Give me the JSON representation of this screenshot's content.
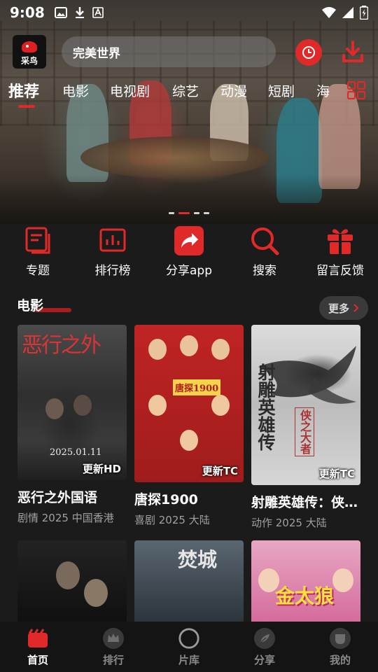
{
  "status_bar": {
    "time": "9:08",
    "icons_left": [
      "image-icon",
      "download-icon",
      "font-icon"
    ],
    "icons_right": [
      "wifi-icon",
      "signal-icon",
      "battery-icon"
    ]
  },
  "header": {
    "logo_text": "采鸟",
    "search_value": "完美世界",
    "history_icon": "history-icon",
    "download_icon": "download-icon"
  },
  "tabs": [
    {
      "label": "推荐",
      "active": true
    },
    {
      "label": "电影",
      "active": false
    },
    {
      "label": "电视剧",
      "active": false
    },
    {
      "label": "综艺",
      "active": false
    },
    {
      "label": "动漫",
      "active": false
    },
    {
      "label": "短剧",
      "active": false
    },
    {
      "label": "海",
      "active": false
    }
  ],
  "banner": {
    "page_count": 4,
    "active_index": 1
  },
  "quick_actions": [
    {
      "label": "专题",
      "icon": "topics-icon"
    },
    {
      "label": "排行榜",
      "icon": "ranking-icon"
    },
    {
      "label": "分享app",
      "icon": "share-icon"
    },
    {
      "label": "搜索",
      "icon": "search-icon"
    },
    {
      "label": "留言反馈",
      "icon": "gift-icon"
    }
  ],
  "movies_section": {
    "title": "电影",
    "more_label": "更多",
    "items": [
      {
        "title": "恶行之外国语",
        "meta": "剧情 2025 中国香港",
        "badge": "更新HD",
        "poster_title": "恶行之外",
        "poster_date": "2025.01.11"
      },
      {
        "title": "唐探1900",
        "meta": "喜剧 2025 大陆",
        "badge": "更新TC",
        "poster_title": "唐探1900"
      },
      {
        "title": "射雕英雄传：侠之大者",
        "meta": "动作 2025 大陆",
        "badge": "更新TC",
        "poster_title": "射雕英雄传",
        "poster_sub": "侠之大者"
      }
    ],
    "row2": [
      {
        "poster_title": ""
      },
      {
        "poster_title": "焚城"
      },
      {
        "poster_title": "金太狼"
      }
    ]
  },
  "bottom_nav": [
    {
      "label": "首页",
      "icon": "home-icon",
      "active": true
    },
    {
      "label": "排行",
      "icon": "crown-icon",
      "active": false
    },
    {
      "label": "片库",
      "icon": "library-icon",
      "active": false
    },
    {
      "label": "分享",
      "icon": "share-leaf-icon",
      "active": false
    },
    {
      "label": "我的",
      "icon": "profile-icon",
      "active": false
    }
  ],
  "colors": {
    "accent": "#e02a2a",
    "background": "#1b1b1b",
    "nav_background": "#141414",
    "muted_text": "#a0a0a0"
  }
}
